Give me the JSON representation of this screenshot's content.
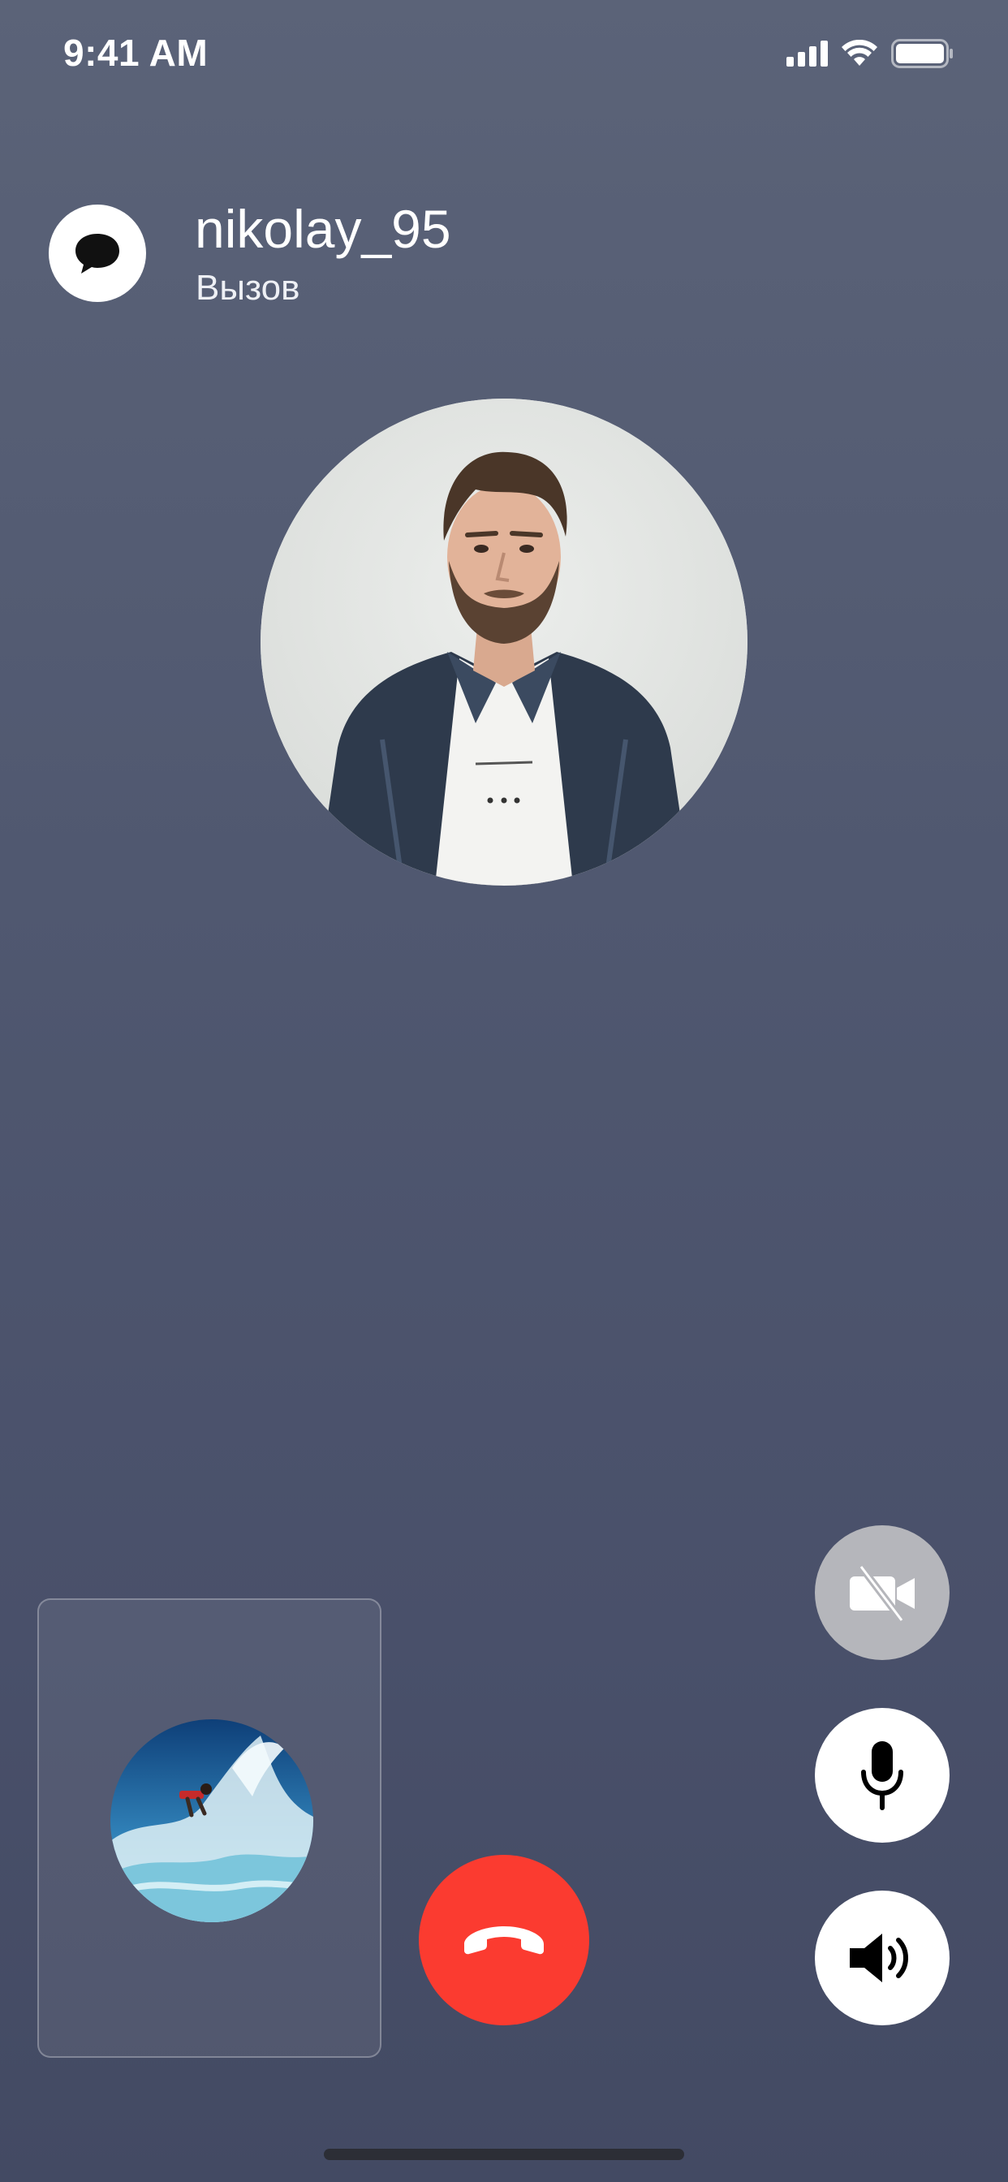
{
  "status_bar": {
    "time": "9:41 AM",
    "icons": [
      "cellular-signal-icon",
      "wifi-icon",
      "battery-icon"
    ]
  },
  "header": {
    "chat_icon": "chat-bubble-icon",
    "contact_name": "nikolay_95",
    "call_status": "Вызов"
  },
  "contact_avatar": {
    "description_icon": "contact-photo"
  },
  "self_preview": {
    "avatar_icon": "surfer-photo"
  },
  "controls": {
    "camera": {
      "icon": "video-off-icon",
      "enabled": false
    },
    "microphone": {
      "icon": "microphone-icon",
      "enabled": true
    },
    "speaker": {
      "icon": "speaker-icon",
      "enabled": true
    },
    "end_call": {
      "icon": "hang-up-icon"
    }
  },
  "colors": {
    "end_call": "#fb3b30",
    "background_top": "#5b6378",
    "background_bottom": "#434a63",
    "disabled_button": "#b5b6bb"
  }
}
